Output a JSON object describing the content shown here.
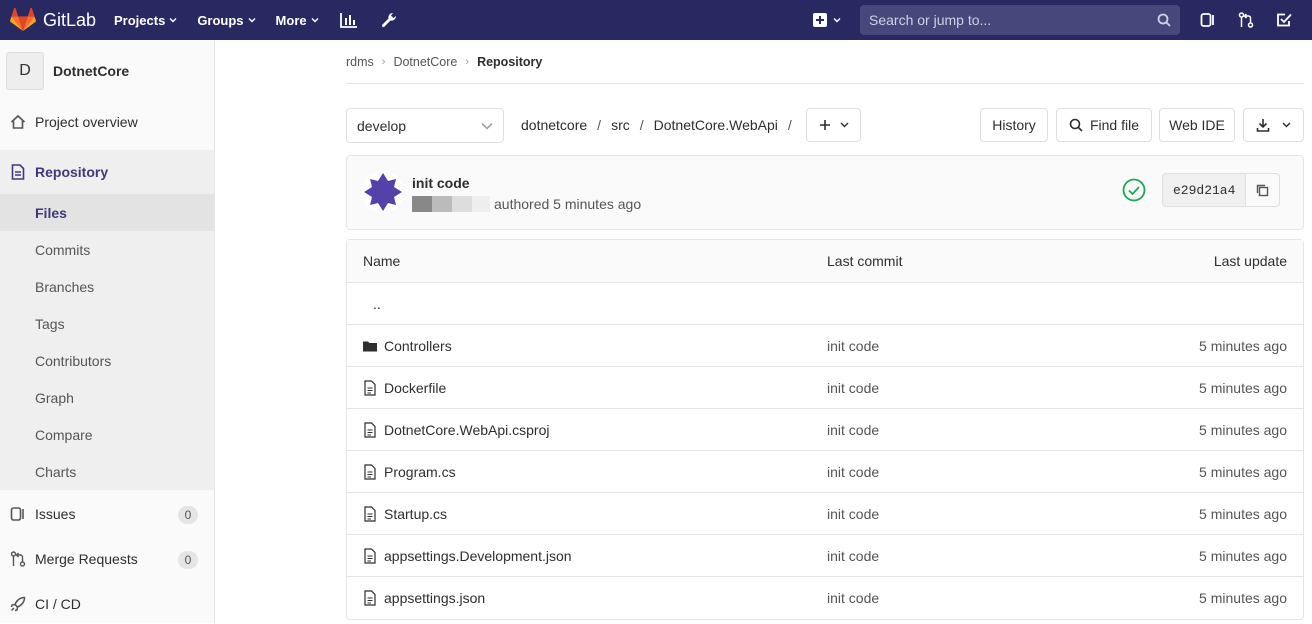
{
  "topbar": {
    "brand": "GitLab",
    "nav": [
      {
        "label": "Projects"
      },
      {
        "label": "Groups"
      },
      {
        "label": "More"
      }
    ],
    "search_placeholder": "Search or jump to..."
  },
  "sidebar": {
    "project_initial": "D",
    "project_name": "DotnetCore",
    "items": [
      {
        "label": "Project overview"
      },
      {
        "label": "Repository"
      },
      {
        "label": "Issues",
        "count": "0"
      },
      {
        "label": "Merge Requests",
        "count": "0"
      },
      {
        "label": "CI / CD"
      }
    ],
    "repository_sub": [
      "Files",
      "Commits",
      "Branches",
      "Tags",
      "Contributors",
      "Graph",
      "Compare",
      "Charts"
    ]
  },
  "breadcrumb": {
    "group": "rdms",
    "project": "DotnetCore",
    "current": "Repository"
  },
  "toolbar": {
    "branch": "develop",
    "path": [
      "dotnetcore",
      "src",
      "DotnetCore.WebApi"
    ],
    "history": "History",
    "find_file": "Find file",
    "web_ide": "Web IDE"
  },
  "commit": {
    "title": "init code",
    "meta": "authored 5 minutes ago",
    "sha": "e29d21a4",
    "pipeline_status_color": "#1aaa55"
  },
  "tree": {
    "headers": {
      "name": "Name",
      "last_commit": "Last commit",
      "last_update": "Last update"
    },
    "parent": "..",
    "rows": [
      {
        "name": "Controllers",
        "type": "folder",
        "commit": "init code",
        "updated": "5 minutes ago"
      },
      {
        "name": "Dockerfile",
        "type": "file",
        "commit": "init code",
        "updated": "5 minutes ago"
      },
      {
        "name": "DotnetCore.WebApi.csproj",
        "type": "file",
        "commit": "init code",
        "updated": "5 minutes ago"
      },
      {
        "name": "Program.cs",
        "type": "file",
        "commit": "init code",
        "updated": "5 minutes ago"
      },
      {
        "name": "Startup.cs",
        "type": "file",
        "commit": "init code",
        "updated": "5 minutes ago"
      },
      {
        "name": "appsettings.Development.json",
        "type": "file",
        "commit": "init code",
        "updated": "5 minutes ago"
      },
      {
        "name": "appsettings.json",
        "type": "file",
        "commit": "init code",
        "updated": "5 minutes ago"
      }
    ]
  }
}
